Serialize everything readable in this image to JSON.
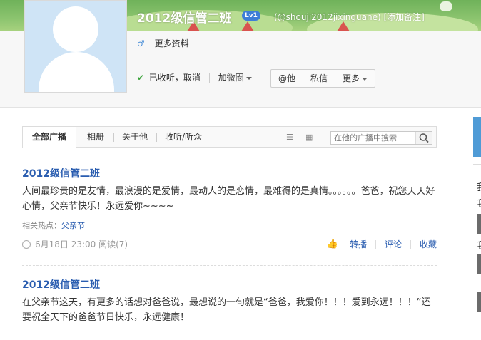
{
  "profile": {
    "name": "2012级信管二班",
    "level_badge": "Lv1",
    "handle": "(@shouji2012jixinguane)",
    "add_note": "[添加备注]",
    "more_info": "更多资料",
    "gender_icon": "male-icon",
    "following_status": "已收听，取消",
    "add_to_circle": "加微圈",
    "buttons": [
      "@他",
      "私信",
      "更多"
    ]
  },
  "tabs": {
    "items": [
      "全部广播",
      "相册",
      "关于他",
      "收听/听众"
    ],
    "active": "全部广播",
    "search_placeholder": "在他的广播中搜索"
  },
  "posts": [
    {
      "author": "2012级信管二班",
      "text": "人间最珍贵的是友情，最浪漫的是爱情，最动人的是恋情，最难得的是真情。。。。。。爸爸，祝您天天好心情，父亲节快乐！永远爱你~~~~",
      "hot_label": "相关热点：",
      "hot_topic": "父亲节",
      "meta": "6月18日 23:00 阅读(7)",
      "actions": [
        "转播",
        "评论",
        "收藏"
      ]
    },
    {
      "author": "2012级信管二班",
      "text": "在父亲节这天，有更多的话想对爸爸说，最想说的一句就是“爸爸，我爱你！！！爱到永远！！！”还要祝全天下的爸爸节日快乐，永远健康！"
    }
  ],
  "colors": {
    "link": "#2a5db0",
    "banner": "#8cc46f",
    "badge": "#3d7ed7",
    "check": "#39a239"
  }
}
